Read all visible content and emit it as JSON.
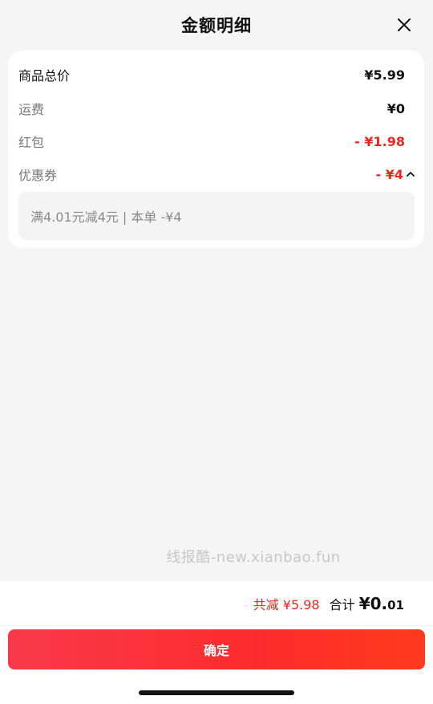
{
  "header": {
    "title": "金额明细",
    "close_icon": "close-icon"
  },
  "rows": {
    "total_price": {
      "label": "商品总价",
      "value": "¥5.99"
    },
    "shipping": {
      "label": "运费",
      "value": "¥0"
    },
    "red_packet": {
      "label": "红包",
      "value": "- ¥1.98"
    },
    "coupon": {
      "label": "优惠券",
      "value": "- ¥4",
      "toggle_icon": "chevron-up-icon"
    }
  },
  "coupon_detail": "满4.01元减4元 | 本单 -¥4",
  "watermark": "线报酷-new.xianbao.fun",
  "footer": {
    "savings": "共减 ¥5.98",
    "total_label": "合计",
    "total_integer": "¥0.",
    "total_decimal": "01",
    "confirm_label": "确定"
  },
  "colors": {
    "accent": "#e8281d",
    "button_start": "#f9394a",
    "button_end": "#ff3a1c"
  }
}
